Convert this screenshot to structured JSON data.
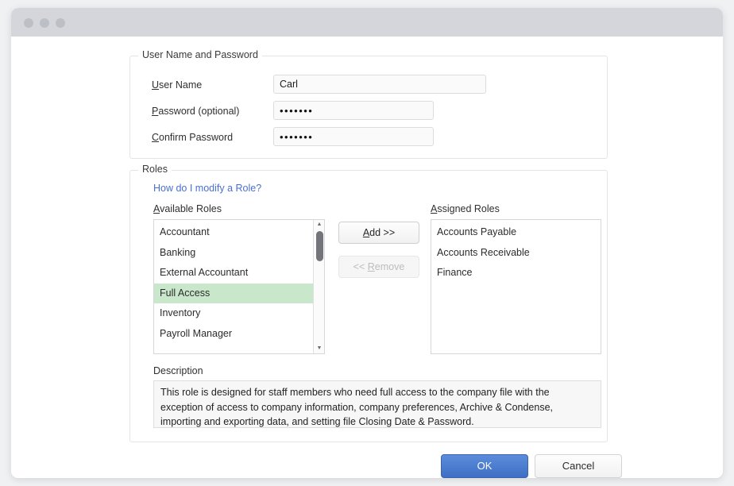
{
  "window": {
    "traffic_lights": [
      "close",
      "minimize",
      "maximize"
    ]
  },
  "credentials_group": {
    "title": "User Name and Password",
    "fields": [
      {
        "label_accel": "U",
        "label_rest": "ser Name",
        "value": "Carl",
        "type": "text"
      },
      {
        "label_accel": "P",
        "label_rest": "assword (optional)",
        "value": "•••••••",
        "type": "password"
      },
      {
        "label_accel": "C",
        "label_rest": "onfirm Password",
        "value": "•••••••",
        "type": "password"
      }
    ]
  },
  "roles_group": {
    "title": "Roles",
    "help_link": "How do I modify a Role?",
    "available_label_accel": "A",
    "available_label_rest": "vailable Roles",
    "assigned_label_accel": "A",
    "assigned_label_rest": "ssigned Roles",
    "available_roles": [
      {
        "label": "Accountant",
        "selected": false
      },
      {
        "label": "Banking",
        "selected": false
      },
      {
        "label": "External Accountant",
        "selected": false
      },
      {
        "label": "Full Access",
        "selected": true
      },
      {
        "label": "Inventory",
        "selected": false
      },
      {
        "label": "Payroll Manager",
        "selected": false
      }
    ],
    "assigned_roles": [
      {
        "label": "Accounts Payable"
      },
      {
        "label": "Accounts Receivable"
      },
      {
        "label": "Finance"
      }
    ],
    "add_button": {
      "accel": "A",
      "rest": "dd >>",
      "enabled": true
    },
    "remove_button": {
      "prefix": "<< ",
      "accel": "R",
      "rest": "emove",
      "enabled": false
    },
    "description_label": "Description",
    "description_text": "This role is designed for staff members who need full access to the company file with the exception of access to company information, company preferences, Archive & Condense, importing and exporting data, and setting file Closing Date & Password."
  },
  "footer": {
    "ok_label": "OK",
    "cancel_label": "Cancel"
  },
  "colors": {
    "selection_green": "#c9e8cb",
    "link_blue": "#4a6fd4",
    "primary_button": "#3f6fc4",
    "titlebar": "#d4d6db"
  }
}
